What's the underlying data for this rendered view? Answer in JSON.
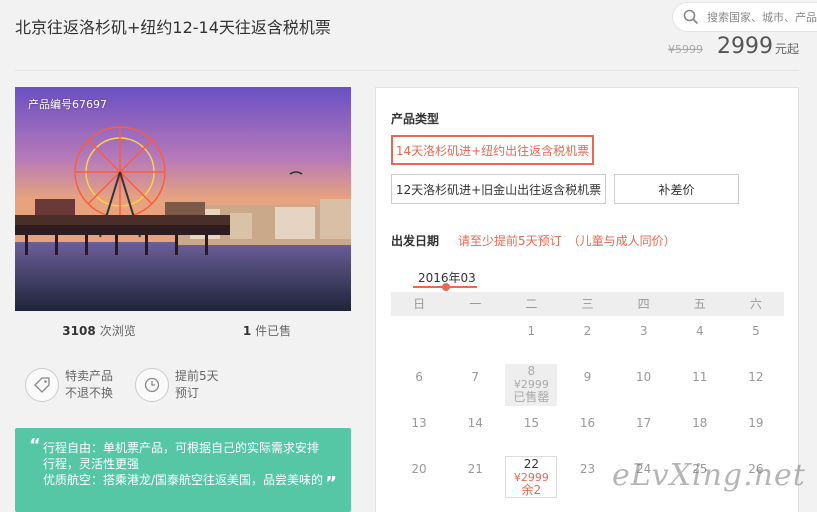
{
  "header": {
    "title": "北京往返洛杉矶+纽约12-14天往返含税机票",
    "search_placeholder": "搜索国家、城市、产品"
  },
  "price": {
    "old": "¥5999",
    "current": "2999",
    "suffix": "元起"
  },
  "product": {
    "number_label": "产品编号67697"
  },
  "stats": {
    "views_count": "3108",
    "views_label": "次浏览",
    "sold_count": "1",
    "sold_label": "件已售"
  },
  "features": [
    {
      "icon": "tag-icon",
      "line1": "特卖产品",
      "line2": "不退不换"
    },
    {
      "icon": "clock-icon",
      "line1": "提前5天",
      "line2": "预订"
    }
  ],
  "promo": {
    "line1": "行程自由：单机票产品，可根据自己的实际需求安排",
    "line2": "行程，灵活性更强",
    "line3": "优质航空：搭乘港龙/国泰航空往返美国，品尝美味的"
  },
  "booking": {
    "product_type_label": "产品类型",
    "options": [
      "14天洛杉矶进+纽约出往返含税机票",
      "12天洛杉矶进+旧金山出往返含税机票",
      "补差价"
    ],
    "date_label": "出发日期",
    "date_note": "请至少提前5天预订　（儿童与成人同价）",
    "month": "2016年03",
    "weekdays": [
      "日",
      "一",
      "二",
      "三",
      "四",
      "五",
      "六"
    ],
    "weeks": [
      [
        "",
        "",
        "1",
        "2",
        "3",
        "4",
        "5"
      ],
      [
        "6",
        "7",
        "8",
        "9",
        "10",
        "11",
        "12"
      ],
      [
        "13",
        "14",
        "15",
        "16",
        "17",
        "18",
        "19"
      ],
      [
        "20",
        "21",
        "22",
        "23",
        "24",
        "25",
        "26"
      ]
    ],
    "special_days": {
      "d8": {
        "day": "8",
        "price": "¥2999",
        "status": "已售罄"
      },
      "d22": {
        "day": "22",
        "price": "¥2999",
        "status": "余2"
      }
    }
  },
  "watermark": "eLvXing.net",
  "colors": {
    "accent": "#e46a53",
    "promo_bg": "#55c7a5"
  }
}
